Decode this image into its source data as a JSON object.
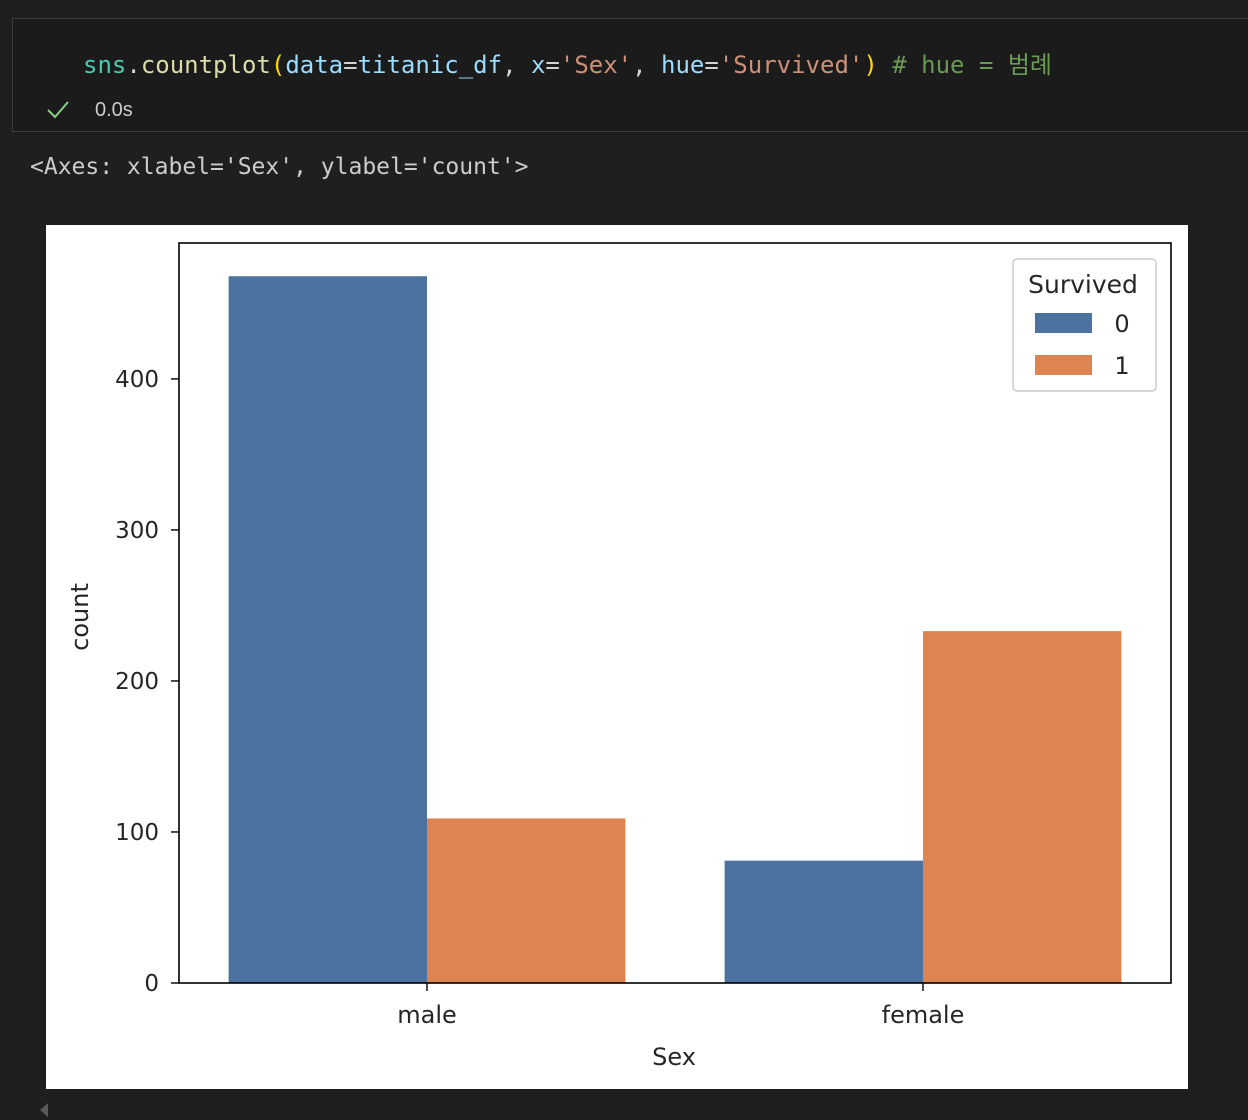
{
  "cell": {
    "code": {
      "obj": "sns",
      "dot": ".",
      "fn": "countplot",
      "open": "(",
      "p1": "data",
      "eq1": "=",
      "v1": "titanic_df",
      "c1": ", ",
      "p2": "x",
      "eq2": "=",
      "v2": "'Sex'",
      "c2": ", ",
      "p3": "hue",
      "eq3": "=",
      "v3": "'Survived'",
      "close": ")",
      "comment": " # hue = 범례"
    },
    "status": {
      "icon": "check-icon",
      "duration": "0.0s"
    }
  },
  "output": {
    "repr": "<Axes: xlabel='Sex', ylabel='count'>"
  },
  "chart_data": {
    "type": "bar",
    "categories": [
      "male",
      "female"
    ],
    "series": [
      {
        "name": "0",
        "values": [
          468,
          81
        ],
        "color": "#4c72a0"
      },
      {
        "name": "1",
        "values": [
          109,
          233
        ],
        "color": "#dd8452"
      }
    ],
    "xlabel": "Sex",
    "ylabel": "count",
    "ylim": [
      0,
      490
    ],
    "yticks": [
      0,
      100,
      200,
      300,
      400
    ],
    "legend_title": "Survived",
    "legend_position": "top-right",
    "grid": false
  }
}
